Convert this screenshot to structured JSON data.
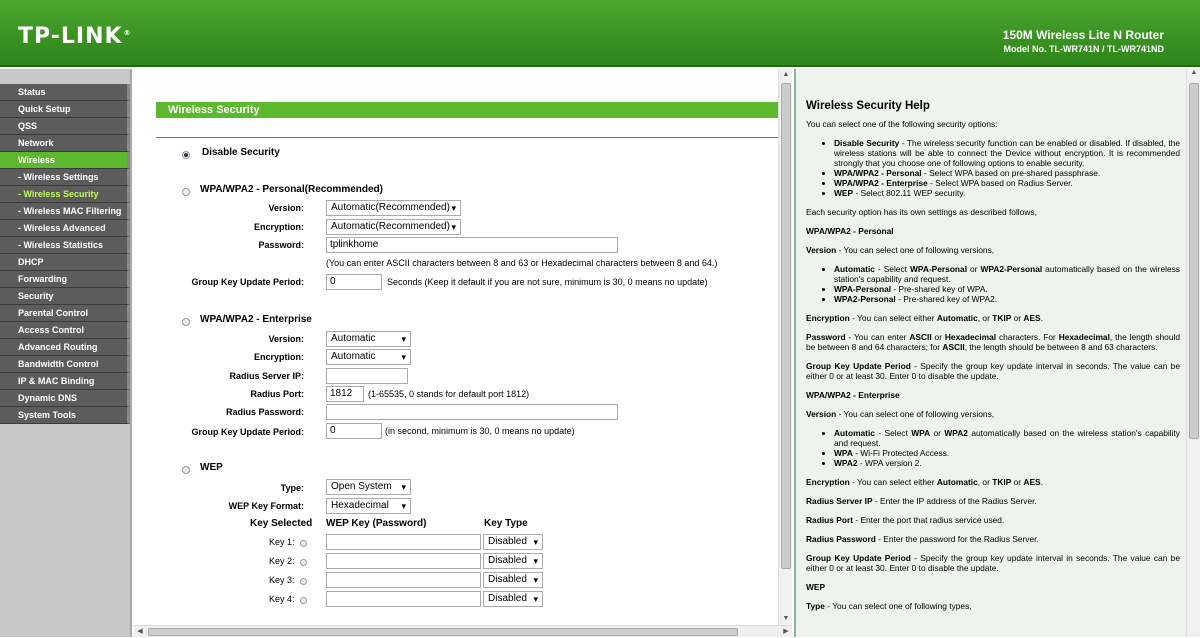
{
  "header": {
    "logo": "TP-LINK",
    "logo_mark": "®",
    "product": "150M Wireless Lite N Router",
    "model": "Model No. TL-WR741N / TL-WR741ND"
  },
  "sidebar": {
    "items": [
      {
        "label": "Status"
      },
      {
        "label": "Quick Setup"
      },
      {
        "label": "QSS"
      },
      {
        "label": "Network"
      },
      {
        "label": "Wireless"
      },
      {
        "label": "- Wireless Settings"
      },
      {
        "label": "- Wireless Security"
      },
      {
        "label": "- Wireless MAC Filtering"
      },
      {
        "label": "- Wireless Advanced"
      },
      {
        "label": "- Wireless Statistics"
      },
      {
        "label": "DHCP"
      },
      {
        "label": "Forwarding"
      },
      {
        "label": "Security"
      },
      {
        "label": "Parental Control"
      },
      {
        "label": "Access Control"
      },
      {
        "label": "Advanced Routing"
      },
      {
        "label": "Bandwidth Control"
      },
      {
        "label": "IP & MAC Binding"
      },
      {
        "label": "Dynamic DNS"
      },
      {
        "label": "System Tools"
      }
    ]
  },
  "main": {
    "title": "Wireless Security",
    "disable": {
      "label": "Disable Security"
    },
    "personal": {
      "label": "WPA/WPA2 - Personal(Recommended)",
      "version_label": "Version:",
      "version": "Automatic(Recommended)",
      "encryption_label": "Encryption:",
      "encryption": "Automatic(Recommended)",
      "password_label": "Password:",
      "password": "tplinkhome",
      "password_note": "(You can enter ASCII characters between 8 and 63 or Hexadecimal characters between 8 and 64.)",
      "gkup_label": "Group Key Update Period:",
      "gkup": "0",
      "gkup_note": "Seconds (Keep it default if you are not sure, minimum is 30, 0 means no update)"
    },
    "enterprise": {
      "label": "WPA/WPA2 - Enterprise",
      "version_label": "Version:",
      "version": "Automatic",
      "encryption_label": "Encryption:",
      "encryption": "Automatic",
      "radius_ip_label": "Radius Server IP:",
      "radius_ip": "",
      "radius_port_label": "Radius Port:",
      "radius_port": "1812",
      "radius_port_note": "(1-65535, 0 stands for default port 1812)",
      "radius_pw_label": "Radius Password:",
      "radius_pw": "",
      "gkup_label": "Group Key Update Period:",
      "gkup": "0",
      "gkup_note": "(in second, minimum is 30, 0 means no update)"
    },
    "wep": {
      "label": "WEP",
      "type_label": "Type:",
      "type": "Open System",
      "format_label": "WEP Key Format:",
      "format": "Hexadecimal",
      "col_selected": "Key Selected",
      "col_key": "WEP Key (Password)",
      "col_type": "Key Type",
      "keys": [
        {
          "label": "Key 1:",
          "value": "",
          "type": "Disabled"
        },
        {
          "label": "Key 2:",
          "value": "",
          "type": "Disabled"
        },
        {
          "label": "Key 3:",
          "value": "",
          "type": "Disabled"
        },
        {
          "label": "Key 4:",
          "value": "",
          "type": "Disabled"
        }
      ]
    }
  },
  "help": {
    "title": "Wireless Security Help",
    "intro": "You can select one of the following security options:",
    "opt1_b": "Disable Security",
    "opt1": " - The wireless security function can be enabled or disabled. If disabled, the wireless stations will be able to connect the Device without encryption. It is recommended strongly that you choose one of following options to enable security.",
    "opt2_b": "WPA/WPA2 - Personal",
    "opt2": " - Select WPA based on pre-shared passphrase.",
    "opt3_b": "WPA/WPA2 - Enterprise",
    "opt3": " - Select WPA based on Radius Server.",
    "opt4_b": "WEP",
    "opt4": " - Select 802.11 WEP security.",
    "each": "Each security option has its own settings as described follows,",
    "personal_head": "WPA/WPA2 - Personal",
    "version_b": "Version",
    "version_text": " - You can select one of following versions,",
    "p_auto_b": "Automatic",
    "p_auto_1": " - Select ",
    "p_auto_wp": "WPA-Personal",
    "p_auto_or": " or ",
    "p_auto_w2p": "WPA2-Personal",
    "p_auto_2": " automatically based on the wireless station's capability and request.",
    "p_wp_b": "WPA-Personal",
    "p_wp": " - Pre-shared key of WPA.",
    "p_w2p_b": "WPA2-Personal",
    "p_w2p": " - Pre-shared key of WPA2.",
    "enc_b": "Encryption",
    "enc_1": " - You can select either ",
    "enc_auto": "Automatic",
    "enc_or": ", or ",
    "enc_tkip": "TKIP",
    "enc_or2": " or ",
    "enc_aes": "AES",
    "enc_end": ".",
    "pw_b": "Password",
    "pw_1": " - You can enter ",
    "pw_ascii": "ASCII",
    "pw_or": " or ",
    "pw_hex": "Hexadecimal",
    "pw_2": " characters. For ",
    "pw_hex2": "Hexadecimal",
    "pw_3": ", the length should be between 8 and 64 characters; for ",
    "pw_ascii2": "ASCII",
    "pw_4": ", the length should be between 8 and 63 characters.",
    "gk_b": "Group Key Update Period",
    "gk": " - Specify the group key update interval in seconds. The value can be either 0 or at least 30. Enter 0 to disable the update.",
    "ent_head": "WPA/WPA2 - Enterprise",
    "e_auto_b": "Automatic",
    "e_auto_1": " - Select ",
    "e_auto_wpa": "WPA",
    "e_auto_or": " or ",
    "e_auto_wpa2": "WPA2",
    "e_auto_2": " automatically based on the wireless station's capability and request.",
    "e_wpa_b": "WPA",
    "e_wpa": " - Wi-Fi Protected Access.",
    "e_wpa2_b": "WPA2",
    "e_wpa2": " - WPA version 2.",
    "rip_b": "Radius Server IP",
    "rip": " - Enter the IP address of the Radius Server.",
    "rport_b": "Radius Port",
    "rport": " - Enter the port that radius service used.",
    "rpw_b": "Radius Password",
    "rpw": " - Enter the password for the Radius Server.",
    "wep_head": "WEP",
    "type_b": "Type",
    "type_text": " - You can select one of following types,"
  }
}
